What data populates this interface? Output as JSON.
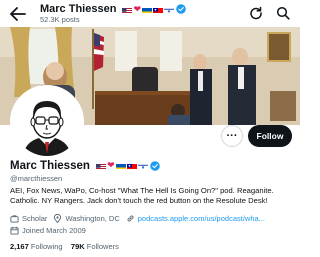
{
  "header": {
    "title": "Marc Thiessen",
    "posts_count": "52.3K posts",
    "icons": [
      "back-arrow-icon",
      "refresh-icon",
      "search-icon"
    ]
  },
  "profile": {
    "name": "Marc Thiessen",
    "handle": "@marcthiessen",
    "name_emoji": [
      "us-flag",
      "red-heart",
      "ukraine-flag",
      "taiwan-flag",
      "israel-flag",
      "verified-badge"
    ],
    "bio": "AEI, Fox News, WaPo, Co-host \"What The Hell Is Going On?\" pod. Reaganite. Catholic. NY Rangers. Jack don't touch the red button on the Resolute Desk!",
    "category": "Scholar",
    "location": "Washington, DC",
    "website": "podcasts.apple.com/us/podcast/wha...",
    "joined": "Joined March 2009",
    "following_count": "2,167",
    "following_label": "Following",
    "followers_count": "79K",
    "followers_label": "Followers"
  },
  "actions": {
    "more_label": "···",
    "follow_label": "Follow"
  },
  "colors": {
    "accent": "#1d9bf0",
    "text": "#0f1419",
    "muted": "#536471",
    "follow_bg": "#0f1419"
  }
}
